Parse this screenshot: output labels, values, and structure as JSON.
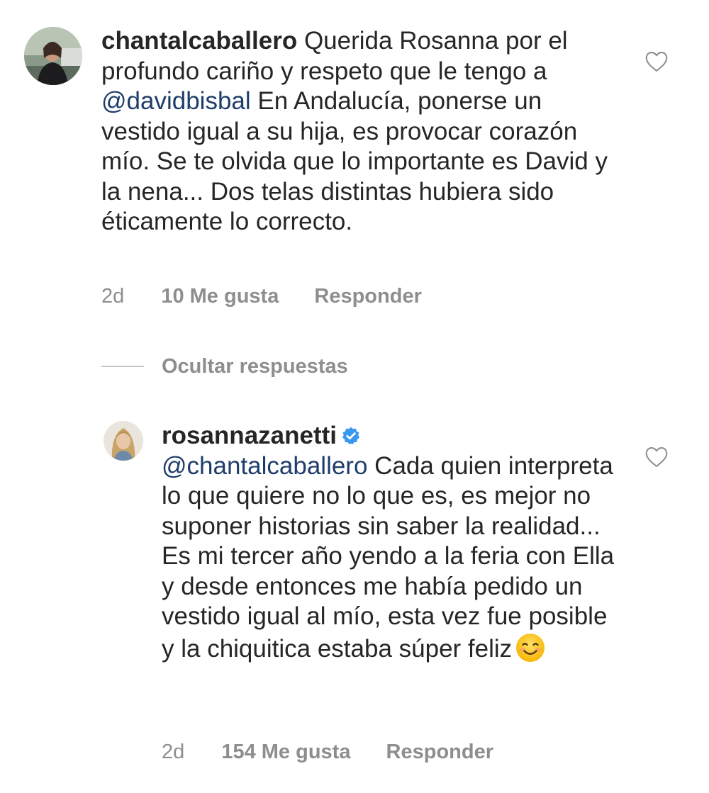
{
  "comment": {
    "username": "chantalcaballero",
    "text_before": " Querida Rosanna por el profundo cariño y respeto que le tengo a ",
    "mention": "@davidbisbal",
    "text_after": " En Andalucía, ponerse un vestido igual a su hija, es provocar corazón mío. Se te olvida que lo importante es David y la nena... Dos telas distintas hubiera sido éticamente lo correcto.",
    "time": "2d",
    "likes": "10 Me gusta",
    "reply": "Responder"
  },
  "hide_replies": "Ocultar respuestas",
  "reply_comment": {
    "username": "rosannazanetti",
    "mention": "@chantalcaballero",
    "text": " Cada quien interpreta lo que quiere no lo que es, es mejor no suponer historias sin saber la realidad... Es mi tercer año yendo a la feria con Ella y desde entonces me había pedido un vestido igual al mío, esta vez fue posible y la chiquitica estaba súper feliz",
    "time": "2d",
    "likes": "154 Me gusta",
    "reply": "Responder"
  },
  "icons": {
    "like": "heart-icon",
    "verified": "verified-badge-icon",
    "emoji": "smiling-face-emoji"
  },
  "colors": {
    "text": "#262626",
    "mention": "#1f3d6b",
    "meta": "#8e8e8e",
    "verified": "#3897f0"
  }
}
